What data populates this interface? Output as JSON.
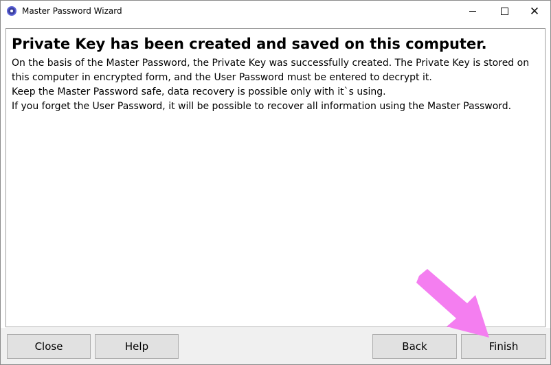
{
  "window": {
    "title": "Master Password Wizard",
    "controls": {
      "minimize": "",
      "maximize": "",
      "close": "✕"
    }
  },
  "content": {
    "heading": "Private Key has been created and saved on this computer.",
    "paragraphs": [
      "On the basis of the Master Password, the Private Key was successfully created. The Private Key is stored on this computer in encrypted form, and the User Password must be entered to decrypt it.",
      "Keep the Master Password safe, data recovery is possible only with it`s using.",
      "If you forget the User Password, it will be possible to recover all information using the Master Password."
    ]
  },
  "footer": {
    "close_label": "Close",
    "help_label": "Help",
    "back_label": "Back",
    "finish_label": "Finish"
  },
  "colors": {
    "annotation_arrow": "#f47ef0",
    "button_face": "#e1e1e1",
    "footer_bg": "#f0f0f0"
  }
}
